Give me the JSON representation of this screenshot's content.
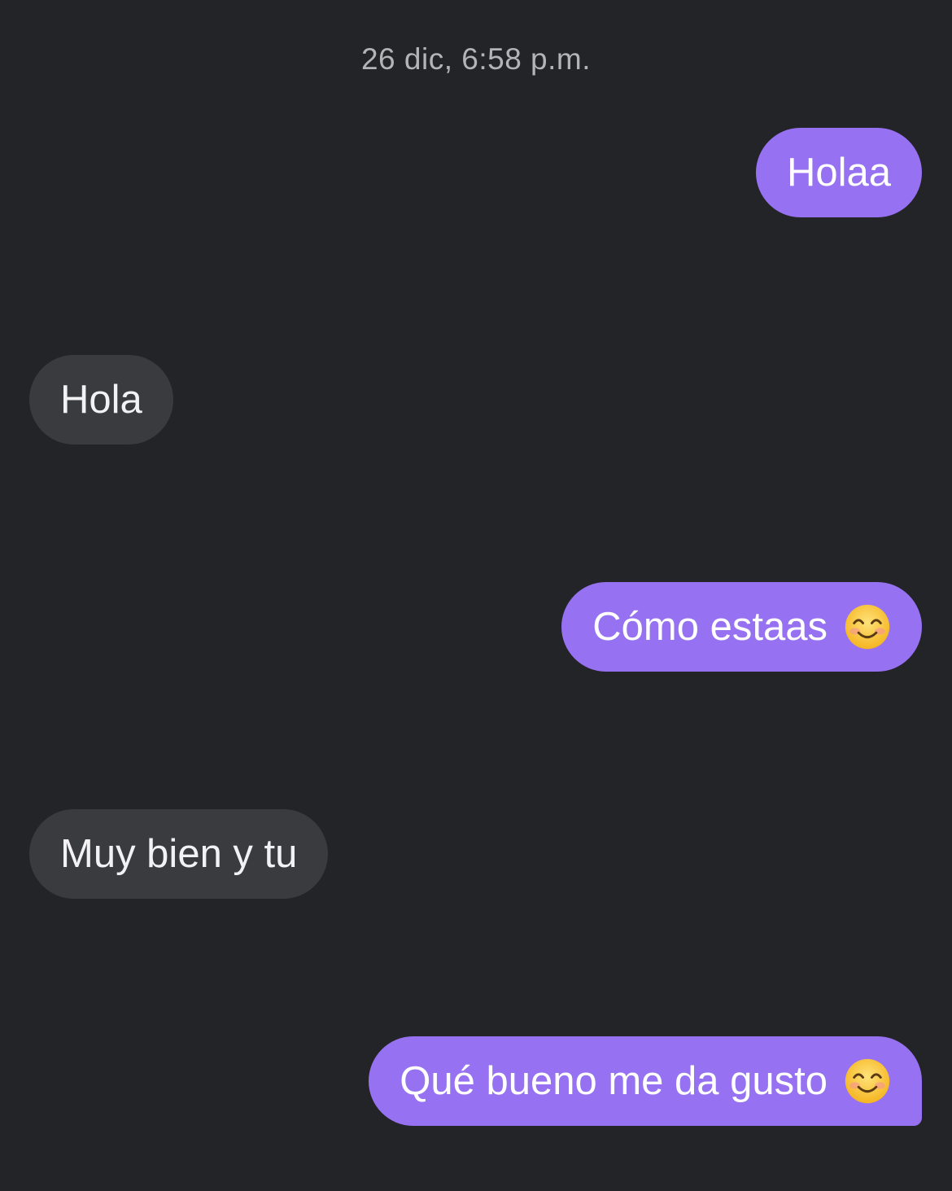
{
  "conversation": {
    "timestamp": "26 dic, 6:58 p.m.",
    "messages": [
      {
        "direction": "sent",
        "text": "Holaa",
        "emoji": null
      },
      {
        "direction": "received",
        "text": "Hola",
        "emoji": null
      },
      {
        "direction": "sent",
        "text": "Cómo estaas",
        "emoji": "smiling-face-icon"
      },
      {
        "direction": "received",
        "text": "Muy bien y tu",
        "emoji": null
      },
      {
        "direction": "sent",
        "text": "Qué bueno me da gusto",
        "emoji": "smiling-face-icon"
      }
    ]
  },
  "colors": {
    "background": "#232427",
    "sent_bubble": "#9672f2",
    "received_bubble": "#3a3b3f",
    "timestamp_text": "#b3b4b8"
  }
}
